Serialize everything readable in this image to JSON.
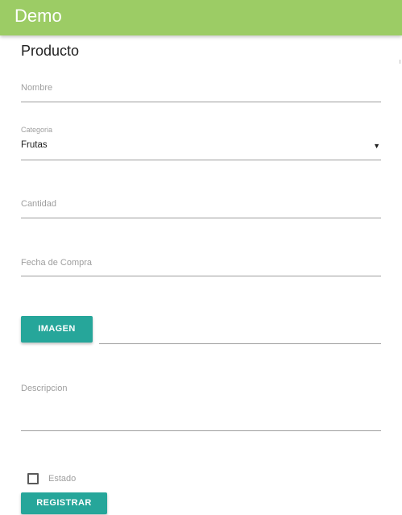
{
  "header": {
    "title": "Demo"
  },
  "form": {
    "title": "Producto",
    "nombre_label": "Nombre",
    "categoria_label": "Categoria",
    "categoria_value": "Frutas",
    "cantidad_label": "Cantidad",
    "fecha_label": "Fecha de Compra",
    "imagen_button": "IMAGEN",
    "descripcion_label": "Descripcion",
    "estado_label": "Estado",
    "estado_checked": false,
    "registrar_button": "REGISTRAR"
  },
  "icons": {
    "select_caret": "▼"
  },
  "colors": {
    "header_bg": "#9ccc65",
    "button_bg": "#26a69a"
  }
}
